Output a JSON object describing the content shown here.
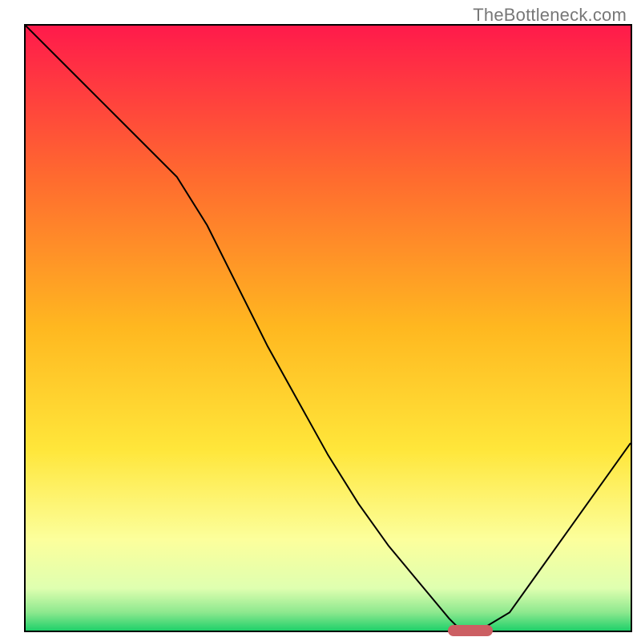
{
  "watermark": "TheBottleneck.com",
  "chart_data": {
    "type": "line",
    "title": "",
    "xlabel": "",
    "ylabel": "",
    "x": [
      0,
      5,
      10,
      15,
      20,
      25,
      30,
      35,
      40,
      45,
      50,
      55,
      60,
      65,
      70,
      72,
      75,
      80,
      85,
      90,
      95,
      100
    ],
    "series": [
      {
        "name": "bottleneck-curve",
        "values": [
          100,
          95,
          90,
          85,
          80,
          75,
          67,
          57,
          47,
          38,
          29,
          21,
          14,
          8,
          2,
          0,
          0,
          3,
          10,
          17,
          24,
          31
        ]
      }
    ],
    "xlim": [
      0,
      100
    ],
    "ylim": [
      0,
      100
    ],
    "gradient_stops": [
      {
        "offset": 0,
        "color": "#ff1a4b"
      },
      {
        "offset": 25,
        "color": "#ff6a2f"
      },
      {
        "offset": 50,
        "color": "#ffb820"
      },
      {
        "offset": 70,
        "color": "#ffe63a"
      },
      {
        "offset": 85,
        "color": "#fcff9c"
      },
      {
        "offset": 93,
        "color": "#dfffb0"
      },
      {
        "offset": 97,
        "color": "#8de88e"
      },
      {
        "offset": 100,
        "color": "#1fd06a"
      }
    ],
    "marker": {
      "x_start": 70,
      "x_end": 77,
      "y": 0,
      "color": "#cc5f63"
    }
  }
}
